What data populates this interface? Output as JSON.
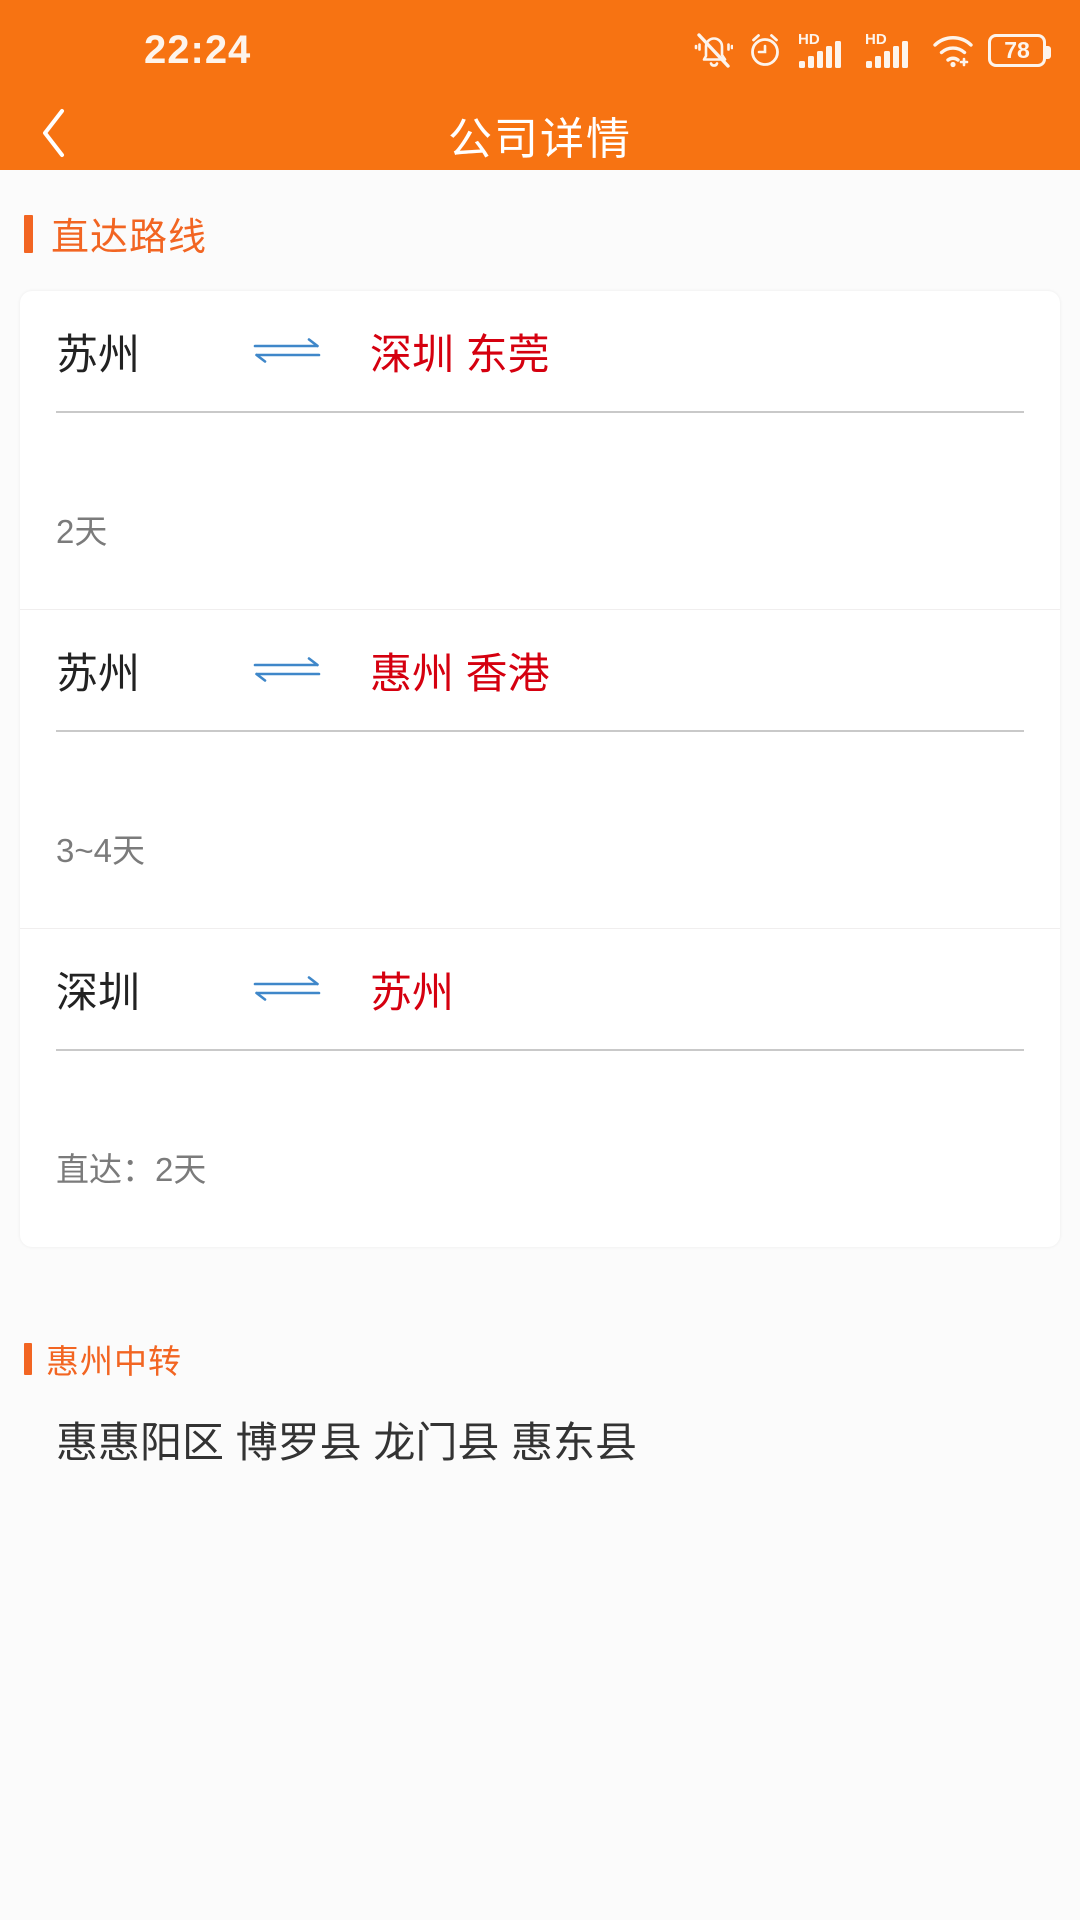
{
  "status_bar": {
    "time": "22:24",
    "battery_level": "78",
    "icons": [
      "mute-vibrate-icon",
      "alarm-icon",
      "hd-signal-icon",
      "hd-signal-icon",
      "wifi-icon",
      "battery-icon"
    ]
  },
  "app_bar": {
    "title": "公司详情",
    "back_icon": "chevron-left-icon"
  },
  "sections": {
    "direct_routes": {
      "title": "直达路线",
      "accent_color": "#F26522"
    },
    "huizhou_transit": {
      "title": "惠州中转",
      "accent_color": "#F26522"
    }
  },
  "routes": [
    {
      "origin": "苏州",
      "arrow": "swap-arrow-icon",
      "destination": "深圳 东莞",
      "duration": "2天"
    },
    {
      "origin": "苏州",
      "arrow": "swap-arrow-icon",
      "destination": "惠州 香港",
      "duration": "3~4天"
    },
    {
      "origin": "深圳",
      "arrow": "swap-arrow-icon",
      "destination": "苏州",
      "duration": "直达：2天"
    }
  ],
  "transit": {
    "areas": "惠惠阳区 博罗县 龙门县 惠东县"
  },
  "colors": {
    "brand_orange": "#F77312",
    "accent_orange": "#F26522",
    "destination_red": "#D5000F",
    "origin_black": "#222222",
    "duration_gray": "#7b7b7b",
    "arrow_blue": "#3f87c9",
    "page_bg": "#fbfbfb",
    "card_bg": "#ffffff"
  }
}
